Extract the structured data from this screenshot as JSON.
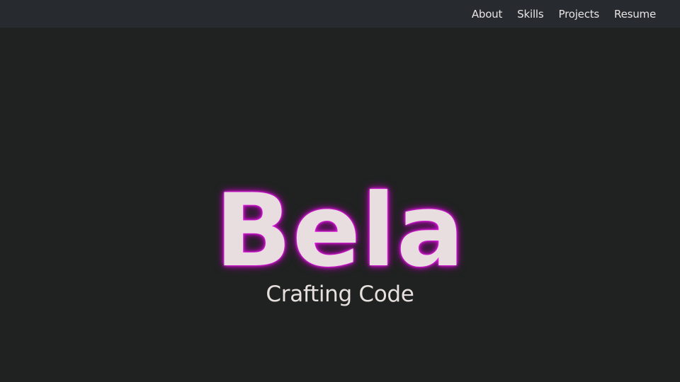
{
  "nav": {
    "items": [
      {
        "label": "About"
      },
      {
        "label": "Skills"
      },
      {
        "label": "Projects"
      },
      {
        "label": "Resume"
      }
    ]
  },
  "hero": {
    "name": "Bela",
    "tagline": "Crafting Code"
  },
  "colors": {
    "background": "#1f2220",
    "navbar": "#272b2f",
    "text": "#e8dedf",
    "glow": "#d020d0"
  }
}
